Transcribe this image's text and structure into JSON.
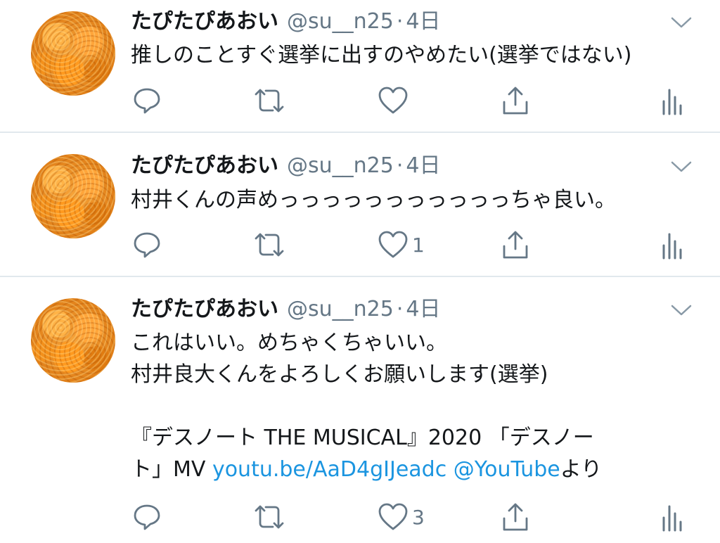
{
  "tweets": [
    {
      "name": "たぴたぴあおい",
      "handle": "@su__n25",
      "dot": "·",
      "time": "4日",
      "lines": [
        "推しのことすぐ選挙に出すのやめたい(選挙ではない)"
      ],
      "like_count": ""
    },
    {
      "name": "たぴたぴあおい",
      "handle": "@su__n25",
      "dot": "·",
      "time": "4日",
      "lines": [
        "村井くんの声めっっっっっっっっっっっちゃ良い。"
      ],
      "like_count": "1"
    },
    {
      "name": "たぴたぴあおい",
      "handle": "@su__n25",
      "dot": "·",
      "time": "4日",
      "lines": [
        "これはいい。めちゃくちゃいい。",
        "村井良大くんをよろしくお願いします(選挙)",
        "『デスノート THE MUSICAL』2020 「デスノー"
      ],
      "last_line": {
        "prefix": "ト」MV ",
        "link_url": "youtu.be/AaD4gIJeadc",
        "link_mention": "@YouTube",
        "suffix": "より"
      },
      "like_count": "3"
    }
  ],
  "icons": {
    "reply": "reply-icon",
    "retweet": "retweet-icon",
    "like": "like-icon",
    "share": "share-icon",
    "analytics": "analytics-icon",
    "caret": "chevron-down-icon"
  },
  "colors": {
    "text": "#14171a",
    "secondary": "#657786",
    "link": "#1b95e0",
    "divider": "#e1e8ed",
    "avatar": "#f39a21"
  }
}
